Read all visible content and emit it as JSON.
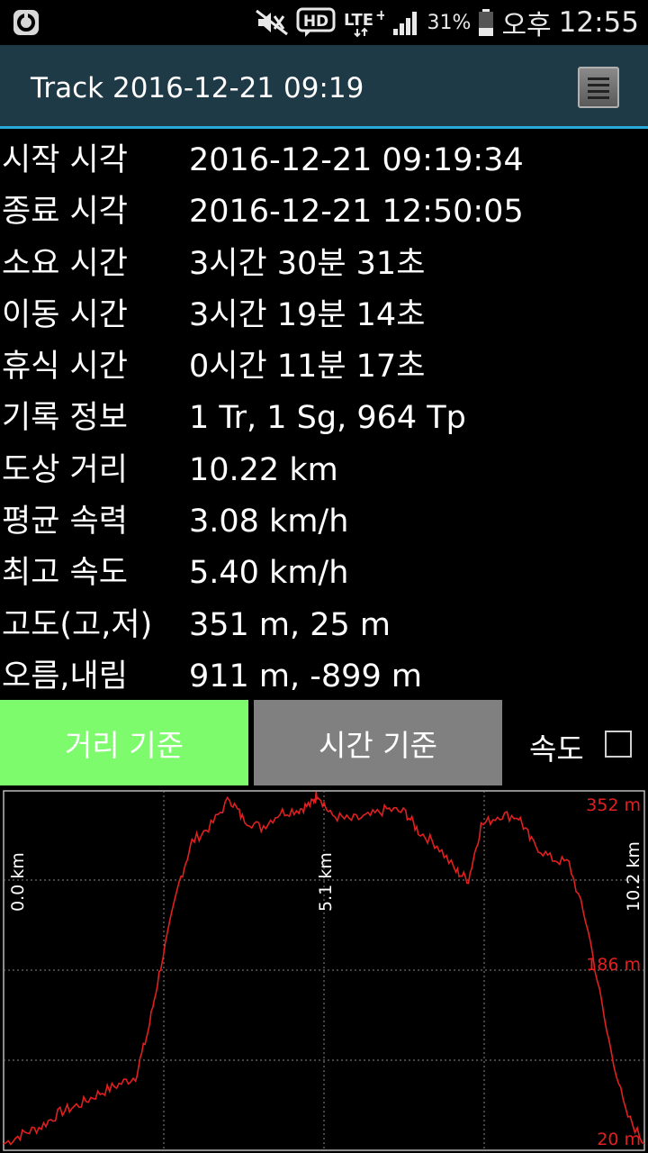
{
  "status_bar": {
    "battery": "31%",
    "ampm": "오후",
    "time": "12:55",
    "icons": [
      "app-icon",
      "mute-icon",
      "hd-icon",
      "lte-icon",
      "signal-icon",
      "battery-icon"
    ]
  },
  "title_bar": {
    "title": "Track 2016-12-21 09:19",
    "menu_icon": "menu-icon"
  },
  "stats": [
    {
      "label": "시작 시각",
      "value": "2016-12-21 09:19:34"
    },
    {
      "label": "종료 시각",
      "value": "2016-12-21 12:50:05"
    },
    {
      "label": "소요 시간",
      "value": "3시간 30분 31초"
    },
    {
      "label": "이동 시간",
      "value": "3시간 19분 14초"
    },
    {
      "label": "휴식 시간",
      "value": "0시간 11분 17초"
    },
    {
      "label": "기록 정보",
      "value": "1 Tr, 1 Sg, 964 Tp"
    },
    {
      "label": "도상 거리",
      "value": "10.22 km"
    },
    {
      "label": "평균 속력",
      "value": "3.08 km/h"
    },
    {
      "label": "최고 속도",
      "value": "5.40 km/h"
    },
    {
      "label": "고도(고,저)",
      "value": "351 m, 25 m"
    },
    {
      "label": "오름,내림",
      "value": "911 m, -899 m"
    }
  ],
  "tabs": {
    "distance": "거리 기준",
    "time": "시간 기준",
    "speed_label": "속도",
    "speed_checked": false,
    "active": "distance"
  },
  "colors": {
    "line": "#e02020",
    "active_tab": "#7dfb6c",
    "inactive_tab": "#808080",
    "title_bg": "#1f3a47",
    "accent": "#2aa8d8"
  },
  "chart_data": {
    "type": "line",
    "xlabel": "",
    "ylabel": "",
    "grid": true,
    "x_ticks": [
      "0.0 km",
      "5.1 km",
      "10.2 km"
    ],
    "y_ticks": [
      "352 m",
      "186 m",
      "20 m"
    ],
    "xlim": [
      0,
      10.2
    ],
    "ylim": [
      20,
      352
    ],
    "x": [
      0,
      0.3,
      0.6,
      0.9,
      1.2,
      1.5,
      1.8,
      2.1,
      2.3,
      2.5,
      2.8,
      3.0,
      3.3,
      3.6,
      3.8,
      4.1,
      4.4,
      4.7,
      4.9,
      5.0,
      5.2,
      5.5,
      5.8,
      6.1,
      6.4,
      6.6,
      6.9,
      7.2,
      7.4,
      7.6,
      7.9,
      8.2,
      8.4,
      8.7,
      9.0,
      9.3,
      9.6,
      9.9,
      10.2
    ],
    "y": [
      26,
      35,
      42,
      55,
      62,
      72,
      80,
      88,
      130,
      190,
      268,
      305,
      320,
      345,
      327,
      318,
      332,
      335,
      340,
      350,
      330,
      325,
      328,
      335,
      332,
      315,
      302,
      278,
      270,
      320,
      330,
      328,
      305,
      290,
      285,
      225,
      130,
      55,
      26
    ]
  }
}
